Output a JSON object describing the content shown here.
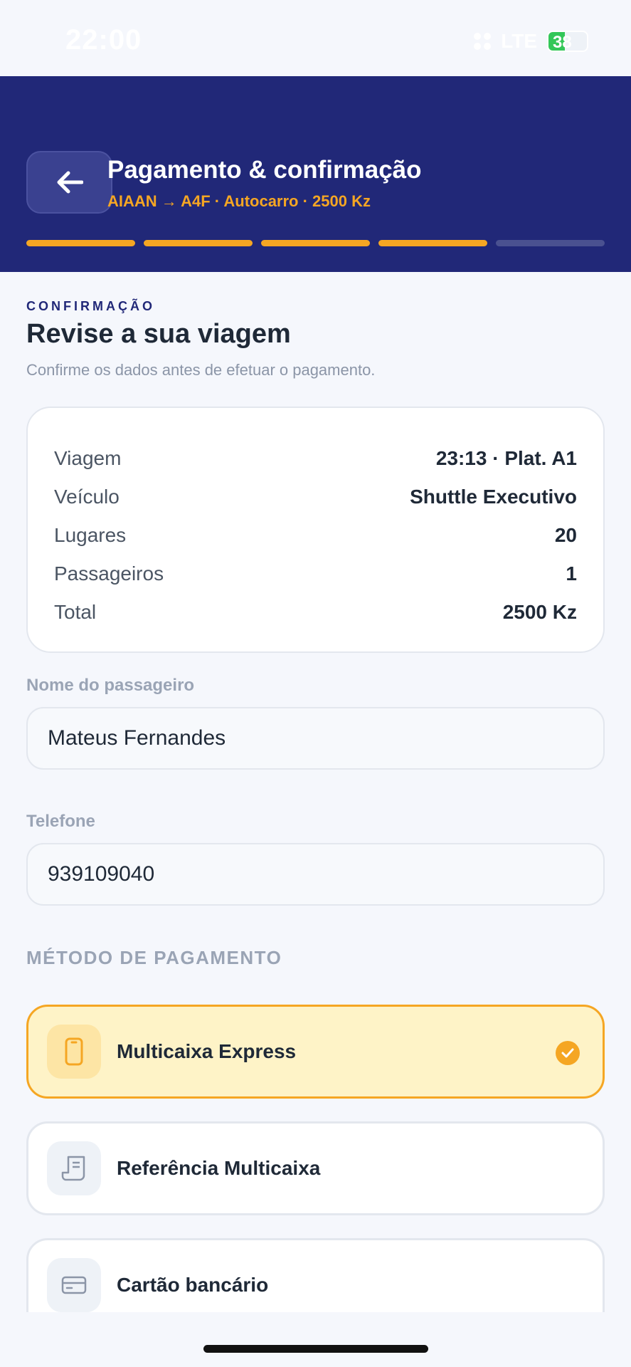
{
  "status_bar": {
    "time": "22:00",
    "network": "LTE",
    "battery": "38"
  },
  "header": {
    "back_icon": "arrow-left-icon",
    "title": "Pagamento & confirmação",
    "subtitle": "AIAAN → A4F · Autocarro · 2500 Kz",
    "progress": {
      "completed_steps": 4,
      "total_steps": 5
    }
  },
  "content": {
    "eyebrow": "CONFIRMAÇÃO",
    "title": "Revise a sua viagem",
    "subtitle": "Confirme os dados antes de efetuar o pagamento.",
    "summary": [
      {
        "label": "Viagem",
        "value": "23:13 · Plat. A1"
      },
      {
        "label": "Veículo",
        "value": "Shuttle Executivo"
      },
      {
        "label": "Lugares",
        "value": "20"
      },
      {
        "label": "Passageiros",
        "value": "1"
      },
      {
        "label": "Total",
        "value": "2500 Kz"
      }
    ],
    "passenger_name": {
      "label": "Nome do passageiro",
      "value": "Mateus Fernandes"
    },
    "phone": {
      "label": "Telefone",
      "value": "939109040"
    },
    "payment_heading": "MÉTODO DE PAGAMENTO",
    "payment_methods": [
      {
        "label": "Multicaixa Express",
        "icon": "phone-icon",
        "selected": true
      },
      {
        "label": "Referência Multicaixa",
        "icon": "receipt-icon",
        "selected": false
      },
      {
        "label": "Cartão bancário",
        "icon": "credit-card-icon",
        "selected": false
      }
    ]
  },
  "colors": {
    "header_bg": "#212878",
    "accent": "#f5a623",
    "selected_bg": "#fef3c7",
    "page_bg": "#f5f7fc"
  }
}
